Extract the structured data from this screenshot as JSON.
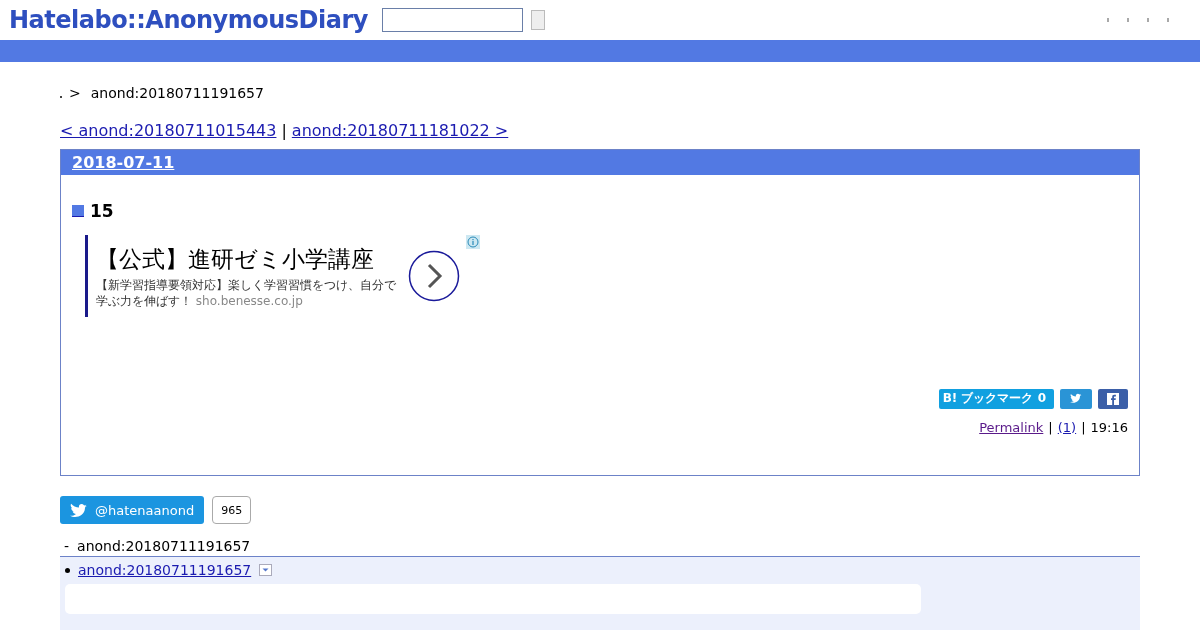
{
  "header": {
    "logo": "Hatelabo::AnonymousDiary",
    "search": {
      "kind": "box"
    }
  },
  "breadcrumb": {
    "separator": ">",
    "current": "anond:20180711191657"
  },
  "pager": {
    "prev": "< anond:20180711015443",
    "divider": "|",
    "next": "anond:20180711181022 >"
  },
  "day": {
    "date": "2018-07-11",
    "entry": {
      "title": "15",
      "ad": {
        "headline": "【公式】進研ゼミ小学講座",
        "body": "【新学習指導要領対応】楽しく学習習慣をつけ、自分で学ぶ力を伸ばす！",
        "domain": "sho.benesse.co.jp"
      },
      "bookmark": "B! ブックマーク 0",
      "footer": {
        "permalink": "Permalink",
        "sep1": "|",
        "comments": "(1)",
        "sep2": "|",
        "time": "19:16"
      }
    }
  },
  "follow": {
    "label": "@hatenaanond",
    "count": "965"
  },
  "references": {
    "heading_mark": "-",
    "heading": "anond:20180711191657",
    "items": [
      {
        "link": "anond:20180711191657"
      }
    ]
  }
}
